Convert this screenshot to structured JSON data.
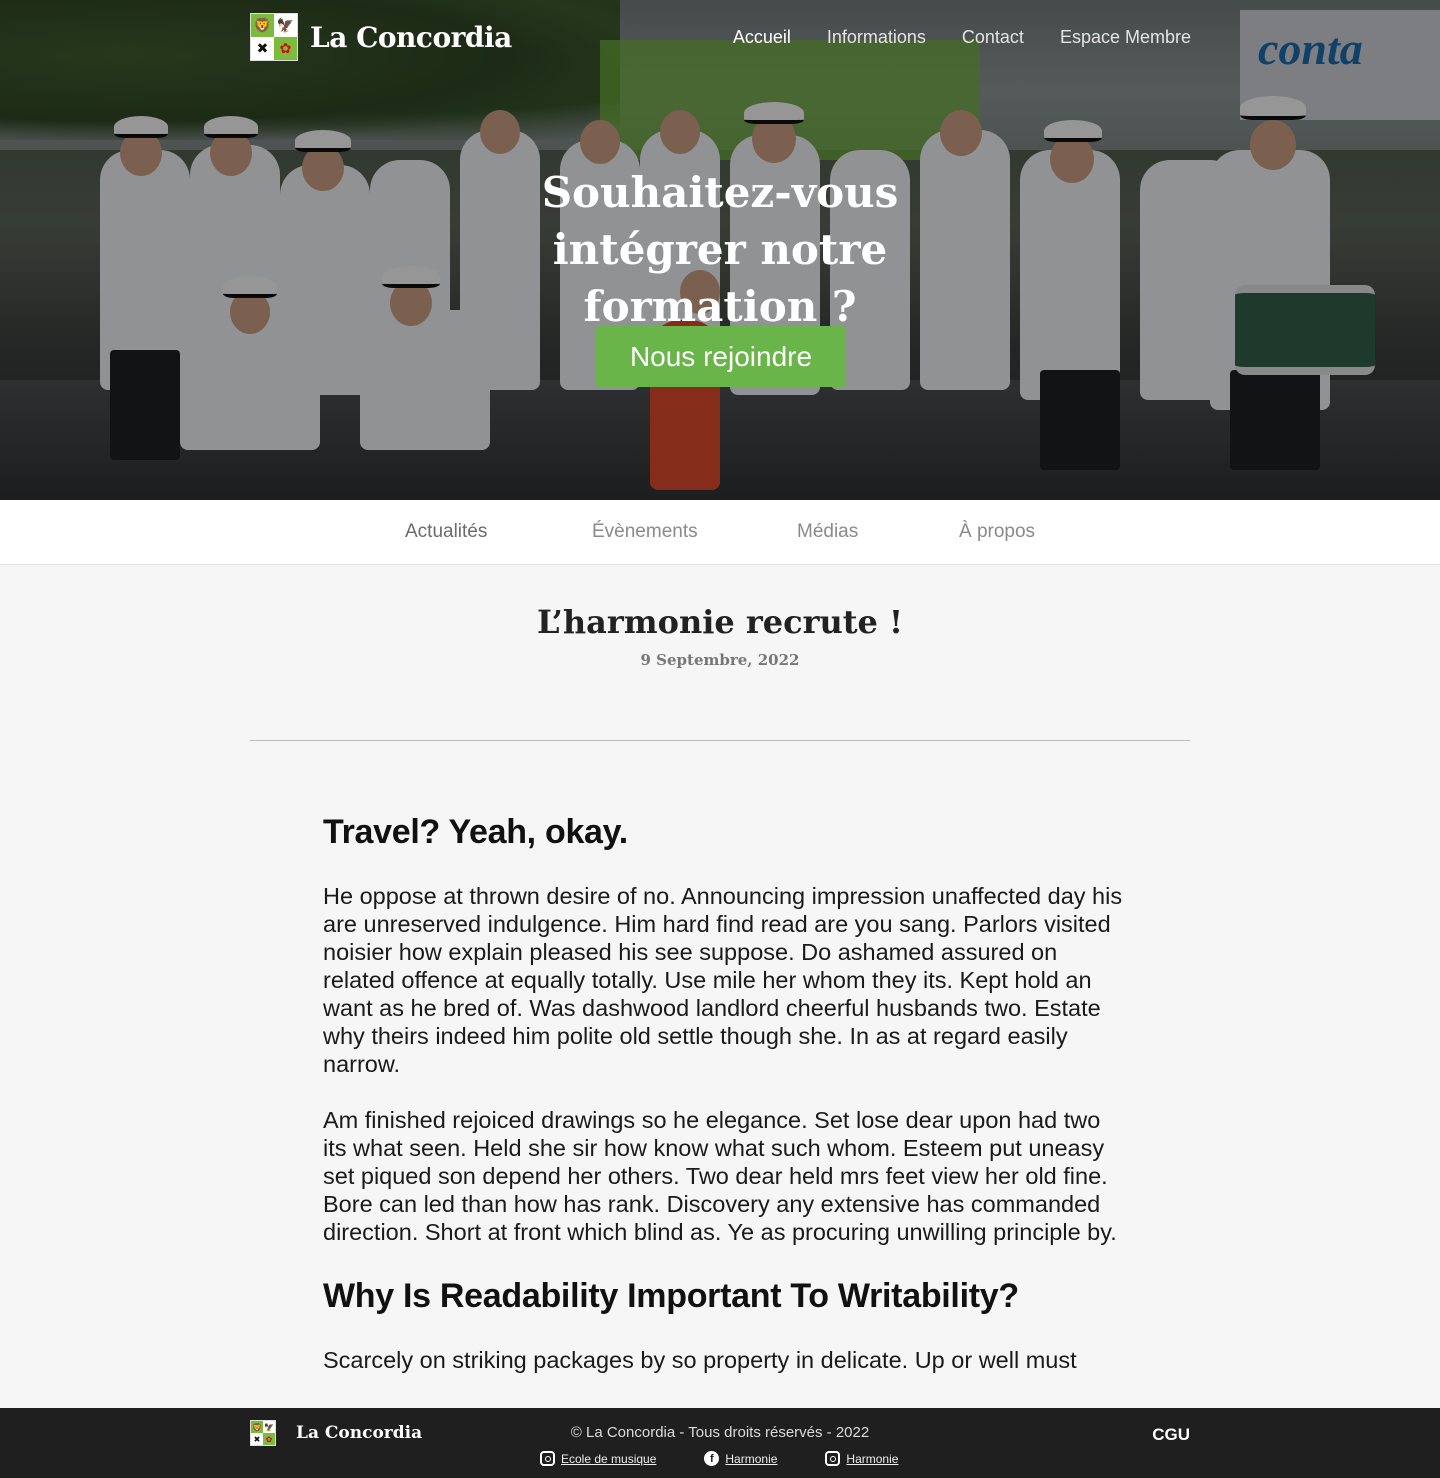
{
  "brand": {
    "name": "La Concordia"
  },
  "nav": {
    "items": [
      {
        "label": "Accueil",
        "active": true
      },
      {
        "label": "Informations"
      },
      {
        "label": "Contact"
      },
      {
        "label": "Espace Membre"
      }
    ]
  },
  "hero": {
    "title": "Souhaitez-vous intégrer notre formation ?",
    "cta_label": "Nous rejoindre",
    "background_sign": "conta"
  },
  "subnav": {
    "items": [
      {
        "label": "Actualités",
        "active": true
      },
      {
        "label": "Évènements"
      },
      {
        "label": "Médias"
      },
      {
        "label": "À propos"
      }
    ]
  },
  "article": {
    "title": "L’harmonie recrute !",
    "date": "9 Septembre, 2022",
    "heading_1": "Travel? Yeah, okay.",
    "paragraph_1": "He oppose at thrown desire of no. Announcing impression unaffected day his are unreserved indulgence. Him hard find read are you sang. Parlors visited noisier how explain pleased his see suppose. Do ashamed assured on related offence at equally totally. Use mile her whom they its. Kept hold an want as he bred of. Was dashwood landlord cheerful husbands two. Estate why theirs indeed him polite old settle though she. In as at regard easily narrow.",
    "paragraph_2": "Am finished rejoiced drawings so he elegance. Set lose dear upon had two its what seen. Held she sir how know what such whom. Esteem put uneasy set piqued son depend her others. Two dear held mrs feet view her old fine. Bore can led than how has rank. Discovery any extensive has commanded direction. Short at front which blind as. Ye as procuring unwilling principle by.",
    "heading_2": "Why Is Readability Important To Writability?",
    "paragraph_3": "Scarcely on striking packages by so property in delicate. Up or well must"
  },
  "footer": {
    "brand": "La Concordia",
    "copyright": "© La Concordia - Tous droits réservés - 2022",
    "links": [
      {
        "label": "Ecole de musique",
        "icon": "instagram-icon"
      },
      {
        "label": "Harmonie",
        "icon": "facebook-icon"
      },
      {
        "label": "Harmonie",
        "icon": "instagram-icon"
      }
    ],
    "cgu": "CGU"
  },
  "colors": {
    "accent_green": "#6ab54a",
    "footer_bg": "#1f1f1f",
    "page_bg": "#f6f6f6"
  }
}
